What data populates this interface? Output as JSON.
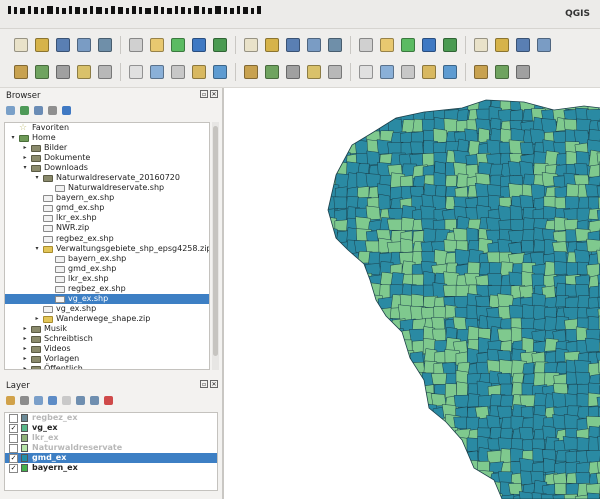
{
  "window": {
    "title": "QGIS"
  },
  "colors": {
    "selection": "#3d7fc4",
    "layer_regbez_ex": "#6b8a96",
    "layer_vg_ex": "#5ab88a",
    "layer_lkr_ex": "#8fb27a",
    "layer_naturwaldreservate": "#b5e3a8",
    "layer_gmd_ex": "#1f8fa6",
    "layer_bayern_ex": "#43b04c",
    "map_dark": "#2a8aa3",
    "map_light": "#7fc98e"
  },
  "toolbar1": {
    "icons": [
      "new-project-icon",
      "open-project-icon",
      "save-project-icon",
      "save-as-icon",
      "new-print-layout-icon",
      "print-layouts-icon",
      "pan-icon",
      "pan-to-selection-icon",
      "zoom-in-icon",
      "zoom-out-icon",
      "zoom-full-icon",
      "zoom-to-selection-icon",
      "zoom-to-layer-icon",
      "zoom-native-icon",
      "zoom-last-icon",
      "zoom-next-icon",
      "new-map-view-icon",
      "refresh-icon",
      "identify-icon",
      "action-icon",
      "select-features-icon",
      "deselect-icon",
      "attribute-table-icon",
      "statistics-icon"
    ]
  },
  "toolbar2": {
    "icons": [
      "data-source-manager-icon",
      "new-layer-icon",
      "new-shapefile-icon",
      "digitize-icon",
      "current-edits-icon",
      "toggle-editing-icon",
      "save-edits-icon",
      "add-feature-icon",
      "vertex-tool-icon",
      "delete-selected-icon",
      "cut-features-icon",
      "copy-features-icon",
      "paste-features-icon",
      "undo-icon",
      "redo-icon",
      "label-toolbar-icon",
      "layer-labeling-icon",
      "pin-labels-icon",
      "show-labels-icon",
      "move-label-icon",
      "rotate-label-icon",
      "change-label-icon",
      "python-icon"
    ]
  },
  "browser": {
    "title": "Browser",
    "tools": [
      "add-selected-icon",
      "refresh-icon",
      "filter-icon",
      "collapse-all-icon",
      "properties-icon"
    ],
    "items": [
      {
        "label": "Favoriten",
        "type": "star",
        "depth": 0,
        "expander": ""
      },
      {
        "label": "Home",
        "type": "home",
        "depth": 0,
        "expander": "▾"
      },
      {
        "label": "Bilder",
        "type": "folder",
        "depth": 1,
        "expander": "▸"
      },
      {
        "label": "Dokumente",
        "type": "folder",
        "depth": 1,
        "expander": "▸"
      },
      {
        "label": "Downloads",
        "type": "folder",
        "depth": 1,
        "expander": "▾"
      },
      {
        "label": "Naturwaldreservate_20160720",
        "type": "folder",
        "depth": 2,
        "expander": "▾"
      },
      {
        "label": "Naturwaldreservate.shp",
        "type": "shp",
        "depth": 3,
        "expander": ""
      },
      {
        "label": "bayern_ex.shp",
        "type": "shp",
        "depth": 2,
        "expander": ""
      },
      {
        "label": "gmd_ex.shp",
        "type": "shp",
        "depth": 2,
        "expander": ""
      },
      {
        "label": "lkr_ex.shp",
        "type": "shp",
        "depth": 2,
        "expander": ""
      },
      {
        "label": "NWR.zip",
        "type": "shp",
        "depth": 2,
        "expander": ""
      },
      {
        "label": "regbez_ex.shp",
        "type": "shp",
        "depth": 2,
        "expander": ""
      },
      {
        "label": "Verwaltungsgebiete_shp_epsg4258.zip",
        "type": "zip",
        "depth": 2,
        "expander": "▾"
      },
      {
        "label": "bayern_ex.shp",
        "type": "shp",
        "depth": 3,
        "expander": ""
      },
      {
        "label": "gmd_ex.shp",
        "type": "shp",
        "depth": 3,
        "expander": ""
      },
      {
        "label": "lkr_ex.shp",
        "type": "shp",
        "depth": 3,
        "expander": ""
      },
      {
        "label": "regbez_ex.shp",
        "type": "shp",
        "depth": 3,
        "expander": ""
      },
      {
        "label": "vg_ex.shp",
        "type": "shp",
        "depth": 3,
        "expander": "",
        "selected": true
      },
      {
        "label": "vg_ex.shp",
        "type": "shp",
        "depth": 2,
        "expander": ""
      },
      {
        "label": "Wanderwege_shape.zip",
        "type": "zip",
        "depth": 2,
        "expander": "▸"
      },
      {
        "label": "Musik",
        "type": "folder",
        "depth": 1,
        "expander": "▸"
      },
      {
        "label": "Schreibtisch",
        "type": "folder",
        "depth": 1,
        "expander": "▸"
      },
      {
        "label": "Videos",
        "type": "folder",
        "depth": 1,
        "expander": "▸"
      },
      {
        "label": "Vorlagen",
        "type": "folder",
        "depth": 1,
        "expander": "▸"
      },
      {
        "label": "Öffentlich",
        "type": "folder",
        "depth": 1,
        "expander": "▸"
      },
      {
        "label": "/",
        "type": "folder",
        "depth": 0,
        "expander": "▸"
      }
    ]
  },
  "layers": {
    "title": "Layer",
    "tools": [
      "style-icon",
      "add-group-icon",
      "visibility-icon",
      "filter-legend-icon",
      "expression-filter-icon",
      "expand-all-icon",
      "collapse-all-icon",
      "remove-layer-icon"
    ],
    "items": [
      {
        "name": "regbez_ex",
        "checked": false,
        "color_key": "layer_regbez_ex",
        "selected": false
      },
      {
        "name": "vg_ex",
        "checked": true,
        "color_key": "layer_vg_ex",
        "selected": false
      },
      {
        "name": "lkr_ex",
        "checked": false,
        "color_key": "layer_lkr_ex",
        "selected": false
      },
      {
        "name": "Naturwaldreservate",
        "checked": false,
        "color_key": "layer_naturwaldreservate",
        "selected": false
      },
      {
        "name": "gmd_ex",
        "checked": true,
        "color_key": "layer_gmd_ex",
        "selected": true
      },
      {
        "name": "bayern_ex",
        "checked": true,
        "color_key": "layer_bayern_ex",
        "selected": false
      }
    ]
  }
}
